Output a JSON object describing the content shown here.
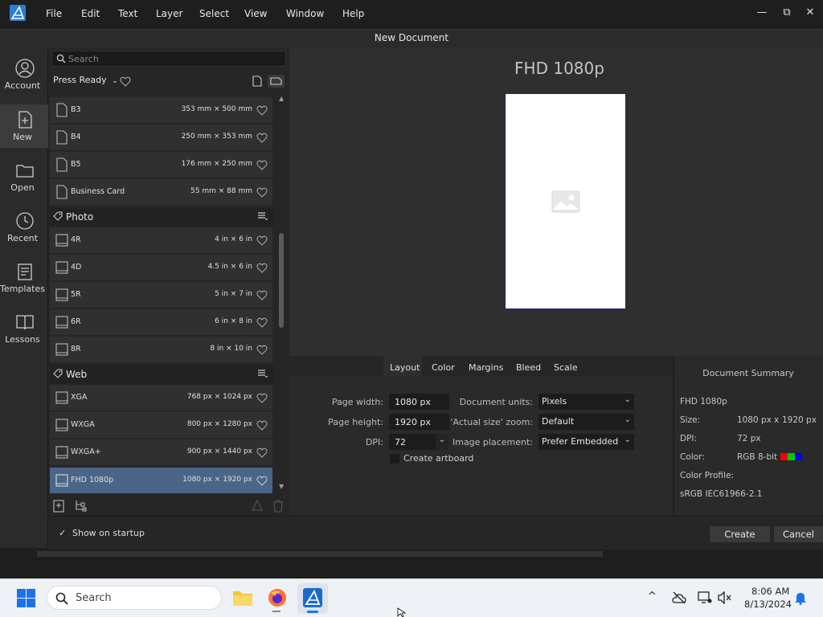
{
  "menu": {
    "items": [
      "File",
      "Edit",
      "Text",
      "Layer",
      "Select",
      "View",
      "Window",
      "Help"
    ]
  },
  "window": {
    "minimize": "—",
    "restore": "⧉",
    "close": "✕"
  },
  "dialog_title": "New Document",
  "nav": {
    "items": [
      "Account",
      "New",
      "Open",
      "Recent",
      "Templates",
      "Lessons"
    ]
  },
  "presets": {
    "search_placeholder": "Search",
    "category": "Press Ready",
    "groups": [
      {
        "name": "",
        "items": [
          {
            "name": "B3",
            "size": "353 mm × 500 mm"
          },
          {
            "name": "B4",
            "size": "250 mm × 353 mm"
          },
          {
            "name": "B5",
            "size": "176 mm × 250 mm"
          },
          {
            "name": "Business Card",
            "size": "55 mm × 88 mm"
          }
        ]
      },
      {
        "name": "Photo",
        "items": [
          {
            "name": "4R",
            "size": "4 in × 6 in"
          },
          {
            "name": "4D",
            "size": "4.5 in × 6 in"
          },
          {
            "name": "5R",
            "size": "5 in × 7 in"
          },
          {
            "name": "6R",
            "size": "6 in × 8 in"
          },
          {
            "name": "8R",
            "size": "8 in × 10 in"
          }
        ]
      },
      {
        "name": "Web",
        "items": [
          {
            "name": "XGA",
            "size": "768 px × 1024 px"
          },
          {
            "name": "WXGA",
            "size": "800 px × 1280 px"
          },
          {
            "name": "WXGA+",
            "size": "900 px × 1440 px"
          },
          {
            "name": "FHD 1080p",
            "size": "1080 px × 1920 px",
            "selected": true
          }
        ]
      }
    ]
  },
  "preview": {
    "title": "FHD 1080p"
  },
  "tabs": [
    "Layout",
    "Color",
    "Margins",
    "Bleed",
    "Scale"
  ],
  "layout": {
    "page_width_label": "Page width:",
    "page_width": "1080 px",
    "page_height_label": "Page height:",
    "page_height": "1920 px",
    "dpi_label": "DPI:",
    "dpi": "72",
    "doc_units_label": "Document units:",
    "doc_units": "Pixels",
    "zoom_label": "'Actual size' zoom:",
    "zoom": "Default",
    "placement_label": "Image placement:",
    "placement": "Prefer Embedded",
    "artboard_label": "Create artboard"
  },
  "summary": {
    "title": "Document Summary",
    "name": "FHD 1080p",
    "size_label": "Size:",
    "size_w": "1080 px",
    "size_x": "x",
    "size_h": "1920 px",
    "dpi_label": "DPI:",
    "dpi": "72 px",
    "color_label": "Color:",
    "color": "RGB 8-bit",
    "profile_label": "Color Profile:",
    "profile": "sRGB IEC61966-2.1"
  },
  "footer": {
    "startup_label": "Show on startup",
    "create": "Create",
    "cancel": "Cancel"
  },
  "taskbar": {
    "search": "Search",
    "time": "8:06 AM",
    "date": "8/13/2024"
  },
  "colors": {
    "accent": "#4a6587",
    "rgb": [
      "#ff0000",
      "#00cc00",
      "#0000ff"
    ]
  }
}
